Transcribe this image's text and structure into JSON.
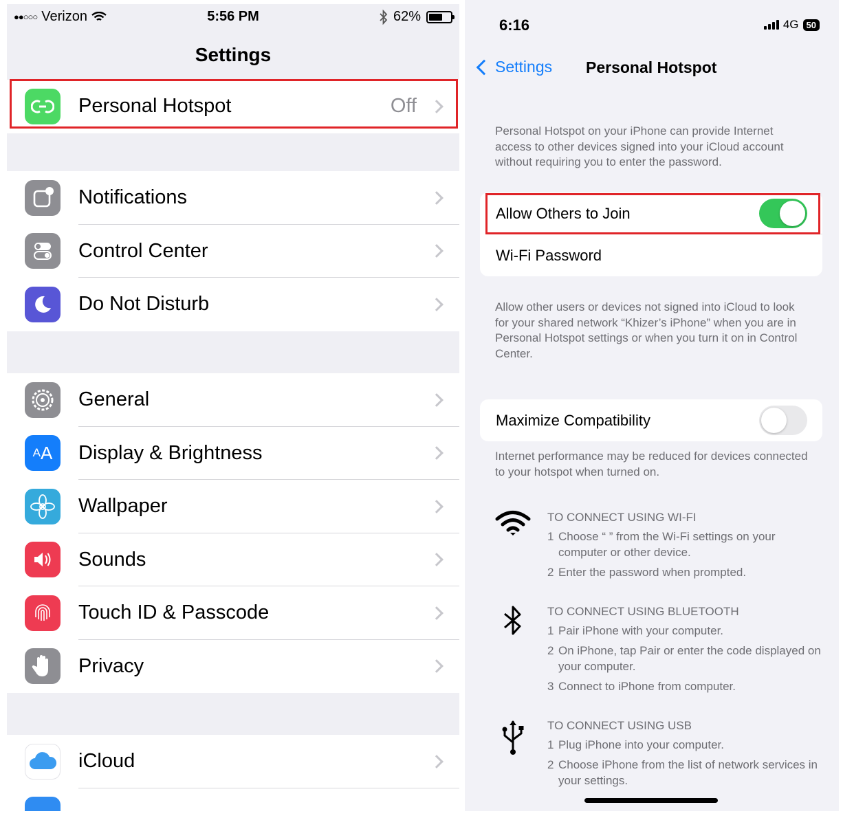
{
  "left": {
    "status": {
      "carrier": "Verizon",
      "time": "5:56 PM",
      "battery": "62%",
      "battery_level": 0.62
    },
    "title": "Settings",
    "hotspot_row": {
      "label": "Personal Hotspot",
      "value": "Off"
    },
    "group2": [
      {
        "label": "Notifications",
        "icon": "notifications-icon",
        "color": "#8e8e93"
      },
      {
        "label": "Control Center",
        "icon": "control-center-icon",
        "color": "#8e8e93"
      },
      {
        "label": "Do Not Disturb",
        "icon": "moon-icon",
        "color": "#5856d6"
      }
    ],
    "group3": [
      {
        "label": "General",
        "icon": "gear-icon",
        "color": "#8e8e93"
      },
      {
        "label": "Display & Brightness",
        "icon": "display-icon",
        "color": "#147efb"
      },
      {
        "label": "Wallpaper",
        "icon": "flower-icon",
        "color": "#35aadc"
      },
      {
        "label": "Sounds",
        "icon": "speaker-icon",
        "color": "#ee3b52"
      },
      {
        "label": "Touch ID & Passcode",
        "icon": "fingerprint-icon",
        "color": "#ee3b52"
      },
      {
        "label": "Privacy",
        "icon": "hand-icon",
        "color": "#8e8e93"
      }
    ],
    "group4": [
      {
        "label": "iCloud",
        "icon": "cloud-icon",
        "color": "#ffffff"
      }
    ],
    "accent_hotspot": "#4cd964",
    "highlight_color": "#e02428"
  },
  "right": {
    "status": {
      "time": "6:16",
      "network": "4G",
      "battery": "50"
    },
    "nav": {
      "back_label": "Settings",
      "title": "Personal Hotspot"
    },
    "intro_note": "Personal Hotspot on your iPhone can provide Internet access to other devices signed into your iCloud account without requiring you to enter the password.",
    "allow_others": {
      "label": "Allow Others to Join",
      "on": true
    },
    "wifi_password": {
      "label": "Wi-Fi Password"
    },
    "allow_note": "Allow other users or devices not signed into iCloud to look for your shared network “Khizer’s iPhone” when you are in Personal Hotspot settings or when you turn it on in Control Center.",
    "maximize": {
      "label": "Maximize Compatibility",
      "on": false
    },
    "maximize_note": "Internet performance may be reduced for devices connected to your hotspot when turned on.",
    "wifi_section": {
      "heading": "TO CONNECT USING WI-FI",
      "steps": [
        {
          "n": "1",
          "text": "Choose “                              ” from the Wi-Fi settings on your computer or other device."
        },
        {
          "n": "2",
          "text": "Enter the password when prompted."
        }
      ]
    },
    "bt_section": {
      "heading": "TO CONNECT USING BLUETOOTH",
      "steps": [
        {
          "n": "1",
          "text": "Pair iPhone with your computer."
        },
        {
          "n": "2",
          "text": "On iPhone, tap Pair or enter the code displayed on your computer."
        },
        {
          "n": "3",
          "text": "Connect to iPhone from computer."
        }
      ]
    },
    "usb_section": {
      "heading": "TO CONNECT USING USB",
      "steps": [
        {
          "n": "1",
          "text": "Plug iPhone into your computer."
        },
        {
          "n": "2",
          "text": "Choose iPhone from the list of network services in your settings."
        }
      ]
    },
    "accent": "#147efb",
    "toggle_on_color": "#34c759"
  }
}
